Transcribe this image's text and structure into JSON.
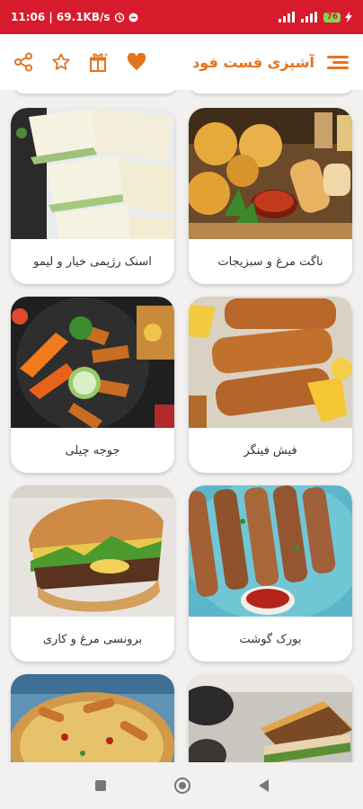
{
  "status_bar": {
    "time_speed": "11:06 | 69.1KB/s",
    "battery": "76"
  },
  "app_bar": {
    "title": "آشپزی فست فود",
    "accent_color": "#e4741f",
    "icons": [
      "share-icon",
      "star-icon",
      "gift-icon",
      "heart-icon",
      "menu-icon"
    ]
  },
  "recipes": [
    {
      "label": "ناگت مرغ و سبزیجات"
    },
    {
      "label": "اسنک رژیمی خیار و لیمو"
    },
    {
      "label": "فیش فینگر"
    },
    {
      "label": "جوجه چیلی"
    },
    {
      "label": "بورک گوشت"
    },
    {
      "label": "برونسی مرغ و کاری"
    }
  ]
}
